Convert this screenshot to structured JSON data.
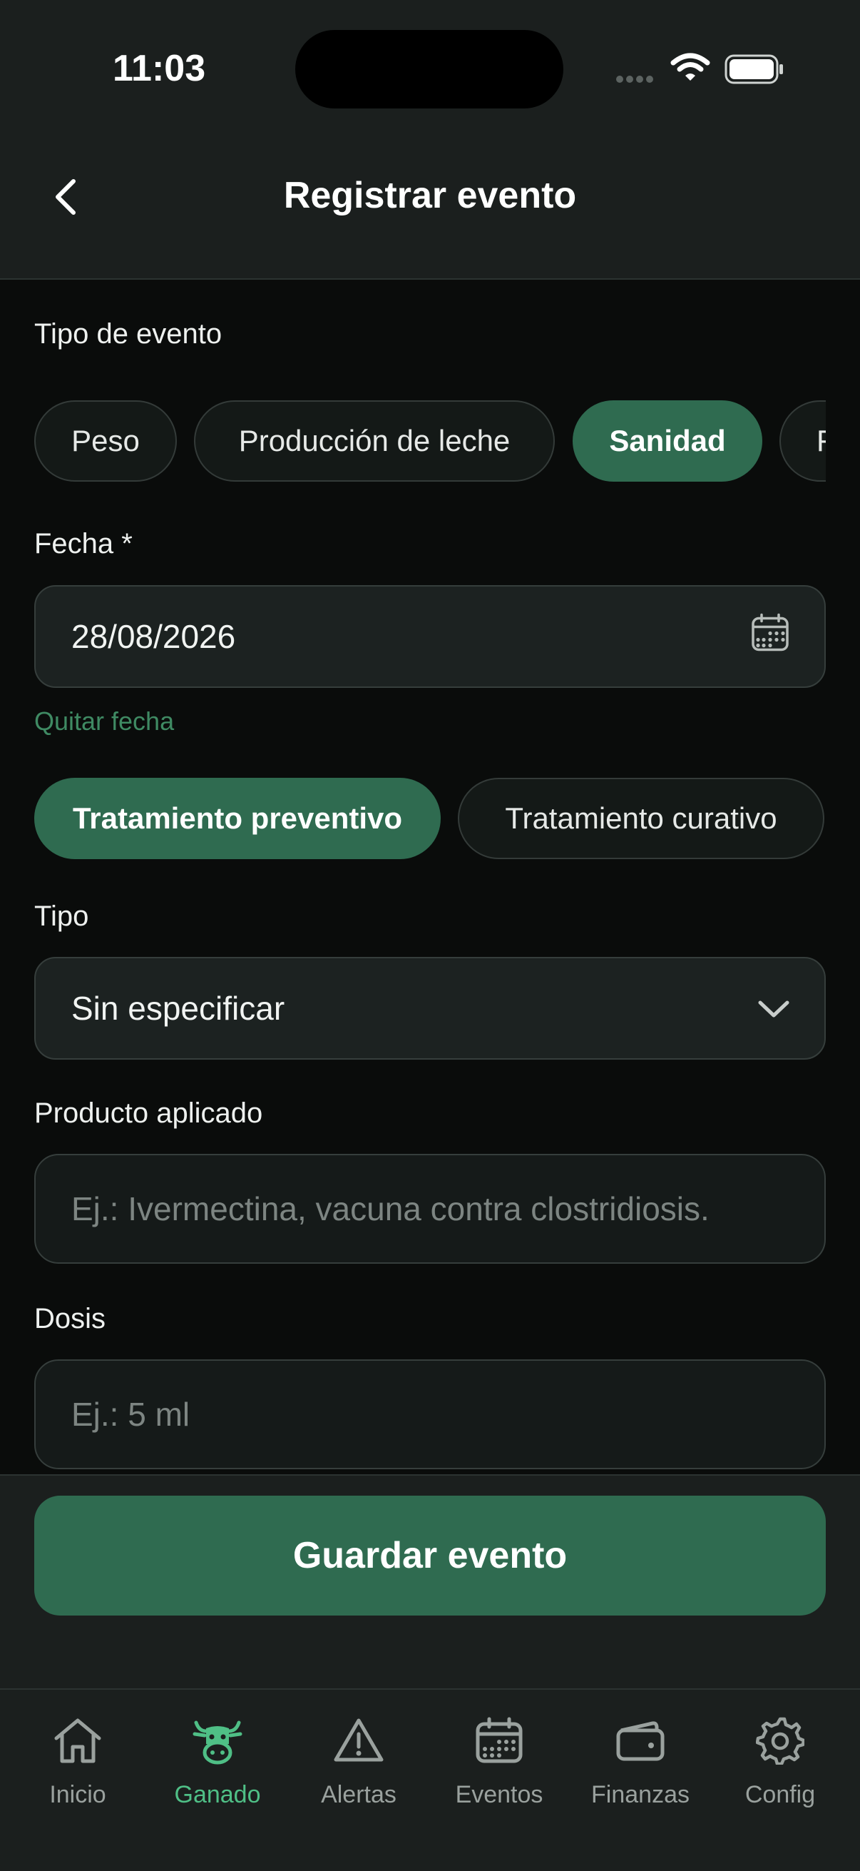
{
  "status": {
    "time": "11:03"
  },
  "header": {
    "title": "Registrar evento"
  },
  "event_type": {
    "label": "Tipo de evento",
    "options": [
      "Peso",
      "Producción de leche",
      "Sanidad",
      "F"
    ],
    "selected": "Sanidad"
  },
  "date": {
    "label": "Fecha *",
    "value": "28/08/2026",
    "clear_label": "Quitar fecha"
  },
  "treatment": {
    "options": [
      "Tratamiento preventivo",
      "Tratamiento curativo"
    ],
    "selected": "Tratamiento preventivo"
  },
  "tipo": {
    "label": "Tipo",
    "value": "Sin especificar"
  },
  "product": {
    "label": "Producto aplicado",
    "placeholder": "Ej.: Ivermectina, vacuna contra clostridiosis."
  },
  "dose": {
    "label": "Dosis",
    "placeholder": "Ej.: 5 ml"
  },
  "save": {
    "label": "Guardar evento"
  },
  "tabs": [
    {
      "label": "Inicio",
      "icon": "house-icon"
    },
    {
      "label": "Ganado",
      "icon": "cow-icon"
    },
    {
      "label": "Alertas",
      "icon": "warning-icon"
    },
    {
      "label": "Eventos",
      "icon": "calendar-icon"
    },
    {
      "label": "Finanzas",
      "icon": "wallet-icon"
    },
    {
      "label": "Config",
      "icon": "gear-icon"
    }
  ],
  "active_tab": "Ganado",
  "colors": {
    "accent": "#2f6b50",
    "accent_text": "#4fbf86",
    "background": "#0a0c0b",
    "surface": "#1b1f1e"
  }
}
